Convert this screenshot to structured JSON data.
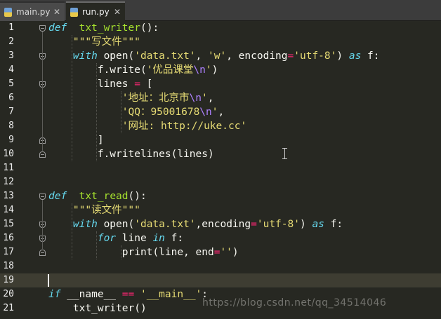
{
  "tabs": [
    {
      "label": "main.py",
      "active": false,
      "close": "✕"
    },
    {
      "label": "run.py",
      "active": true,
      "close": "✕"
    }
  ],
  "lines": [
    {
      "n": "1",
      "t": [
        [
          "kw",
          "def"
        ],
        [
          "",
          "  "
        ],
        [
          "fn",
          "txt_writer"
        ],
        [
          "",
          "():"
        ]
      ]
    },
    {
      "n": "2",
      "t": [
        [
          "",
          "    "
        ],
        [
          "str",
          "\"\"\"写文件\"\"\""
        ]
      ]
    },
    {
      "n": "3",
      "t": [
        [
          "",
          "    "
        ],
        [
          "kw",
          "with"
        ],
        [
          "",
          " open("
        ],
        [
          "str",
          "'data.txt'"
        ],
        [
          "",
          ", "
        ],
        [
          "str",
          "'w'"
        ],
        [
          "",
          ", encoding"
        ],
        [
          "op",
          "="
        ],
        [
          "str",
          "'utf-8'"
        ],
        [
          "",
          ") "
        ],
        [
          "kw",
          "as"
        ],
        [
          "",
          " f:"
        ]
      ]
    },
    {
      "n": "4",
      "t": [
        [
          "",
          "        f.write("
        ],
        [
          "str",
          "'优品课堂"
        ],
        [
          "esc",
          "\\n"
        ],
        [
          "str",
          "'"
        ],
        [
          "",
          ")"
        ]
      ]
    },
    {
      "n": "5",
      "t": [
        [
          "",
          "        lines "
        ],
        [
          "op",
          "="
        ],
        [
          "",
          " ["
        ]
      ]
    },
    {
      "n": "6",
      "t": [
        [
          "",
          "            "
        ],
        [
          "str",
          "'地址：北京市"
        ],
        [
          "esc",
          "\\n"
        ],
        [
          "str",
          "'"
        ],
        [
          "",
          ","
        ]
      ]
    },
    {
      "n": "7",
      "t": [
        [
          "",
          "            "
        ],
        [
          "str",
          "'QQ：95001678"
        ],
        [
          "esc",
          "\\n"
        ],
        [
          "str",
          "'"
        ],
        [
          "",
          ","
        ]
      ]
    },
    {
      "n": "8",
      "t": [
        [
          "",
          "            "
        ],
        [
          "str",
          "'网址: http://uke.cc'"
        ]
      ]
    },
    {
      "n": "9",
      "t": [
        [
          "",
          "        ]"
        ]
      ]
    },
    {
      "n": "10",
      "t": [
        [
          "",
          "        f.writelines(lines)"
        ]
      ]
    },
    {
      "n": "11",
      "t": []
    },
    {
      "n": "12",
      "t": []
    },
    {
      "n": "13",
      "t": [
        [
          "kw",
          "def"
        ],
        [
          "",
          "  "
        ],
        [
          "fn",
          "txt_read"
        ],
        [
          "",
          "():"
        ]
      ]
    },
    {
      "n": "14",
      "t": [
        [
          "",
          "    "
        ],
        [
          "str",
          "\"\"\"读文件\"\"\""
        ]
      ]
    },
    {
      "n": "15",
      "t": [
        [
          "",
          "    "
        ],
        [
          "kw",
          "with"
        ],
        [
          "",
          " open("
        ],
        [
          "str",
          "'data.txt'"
        ],
        [
          "",
          ",encoding"
        ],
        [
          "op",
          "="
        ],
        [
          "str",
          "'utf-8'"
        ],
        [
          "",
          ") "
        ],
        [
          "kw",
          "as"
        ],
        [
          "",
          " f:"
        ]
      ]
    },
    {
      "n": "16",
      "t": [
        [
          "",
          "        "
        ],
        [
          "kw",
          "for"
        ],
        [
          "",
          " line "
        ],
        [
          "kw",
          "in"
        ],
        [
          "",
          " f:"
        ]
      ]
    },
    {
      "n": "17",
      "t": [
        [
          "",
          "            print(line, end"
        ],
        [
          "op",
          "="
        ],
        [
          "str",
          "''"
        ],
        [
          "",
          ")"
        ]
      ]
    },
    {
      "n": "18",
      "t": []
    },
    {
      "n": "19",
      "t": []
    },
    {
      "n": "20",
      "t": [
        [
          "kw",
          "if"
        ],
        [
          "",
          " __name__ "
        ],
        [
          "op",
          "=="
        ],
        [
          "",
          " "
        ],
        [
          "str",
          "'__main__'"
        ],
        [
          "",
          ":"
        ]
      ]
    },
    {
      "n": "21",
      "t": [
        [
          "",
          "    txt_writer()"
        ]
      ]
    }
  ],
  "current_line": 19,
  "watermark": "https://blog.csdn.net/qq_34514046",
  "colors": {
    "background": "#272822",
    "keyword": "#66d9ef",
    "function": "#a6e22e",
    "string": "#e6db74",
    "operator": "#f92672",
    "escape": "#ae81ff"
  }
}
